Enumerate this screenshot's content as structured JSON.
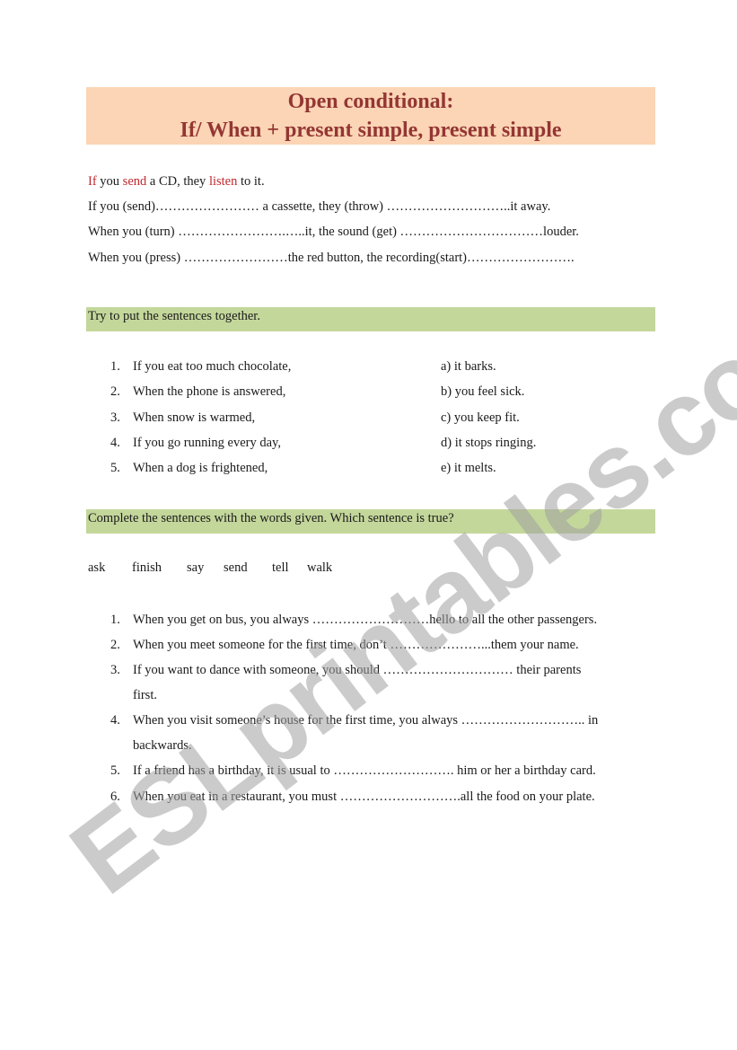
{
  "title": {
    "line1": "Open conditional:",
    "line2": "If/ When + present simple, present simple"
  },
  "example": {
    "if": "If",
    "you": " you ",
    "send": "send",
    "mid": " a CD, they ",
    "listen": "listen",
    "end": " to it."
  },
  "exercise1": [
    "If you (send)…………………… a cassette, they (throw) ………………………..it away.",
    "When you (turn) …………………….…..it, the sound (get) ……………………………louder.",
    "When you (press) ……………………the red button, the recording(start)……………………."
  ],
  "section2": {
    "header": "Try to put the sentences together.",
    "items": [
      {
        "num": "1.",
        "text": "If you eat too much chocolate,"
      },
      {
        "num": "2.",
        "text": "When the phone is  answered,"
      },
      {
        "num": "3.",
        "text": "When snow is warmed,"
      },
      {
        "num": "4.",
        "text": "If you go running every day,"
      },
      {
        "num": "5.",
        "text": "When a dog is frightened,"
      }
    ],
    "answers": [
      "a) it barks.",
      "b) you feel sick.",
      "c) you keep fit.",
      "d) it stops ringing.",
      "e) it melts."
    ]
  },
  "section3": {
    "header": "Complete the sentences with the words given. Which sentence is true?",
    "words": [
      "ask",
      "finish",
      "say",
      "send",
      "tell",
      "walk"
    ],
    "items": [
      {
        "num": "1.",
        "text": "When you get on bus, you always ………………………hello to all the other passengers."
      },
      {
        "num": "2.",
        "text": "When you meet someone for the first time, don’t …………………...them your name."
      },
      {
        "num": "3.",
        "text": "If you want to dance with someone, you should ………………………… their parents",
        "cont": "first."
      },
      {
        "num": "4.",
        "text": "When you visit someone’s house for the first time, you always ……………………….. in",
        "cont": "backwards."
      },
      {
        "num": "5.",
        "text": "If a friend has a birthday, it is usual to ………………………. him or her a birthday card."
      },
      {
        "num": "6.",
        "text": "When you eat in a restaurant, you must ……………………….all the food on your plate."
      }
    ]
  },
  "watermark": "ESLprintables.com"
}
